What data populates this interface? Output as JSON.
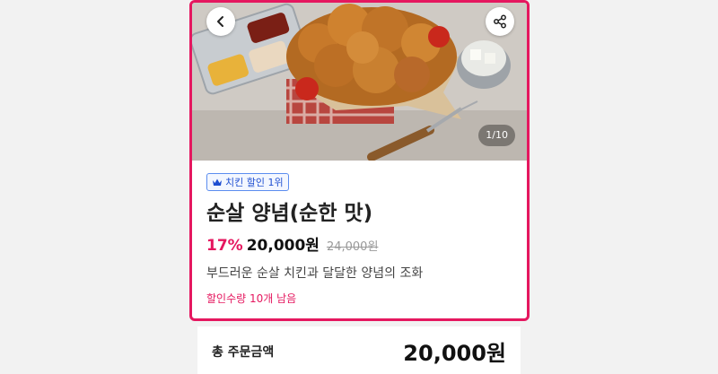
{
  "hero": {
    "image_name": "fried-chicken-photo",
    "counter": "1/10"
  },
  "product": {
    "badge": "치킨 할인 1위",
    "title": "순살 양념(순한 맛)",
    "discount": "17%",
    "price": "20,000원",
    "original_price": "24,000원",
    "description": "부드러운 순살 치킨과 달달한 양념의 조화",
    "remaining": "할인수량 10개 남음"
  },
  "summary": {
    "total_label": "총 주문금액",
    "total_value": "20,000원"
  },
  "colors": {
    "accent": "#e5175f",
    "badge_blue": "#1f4fd1"
  }
}
